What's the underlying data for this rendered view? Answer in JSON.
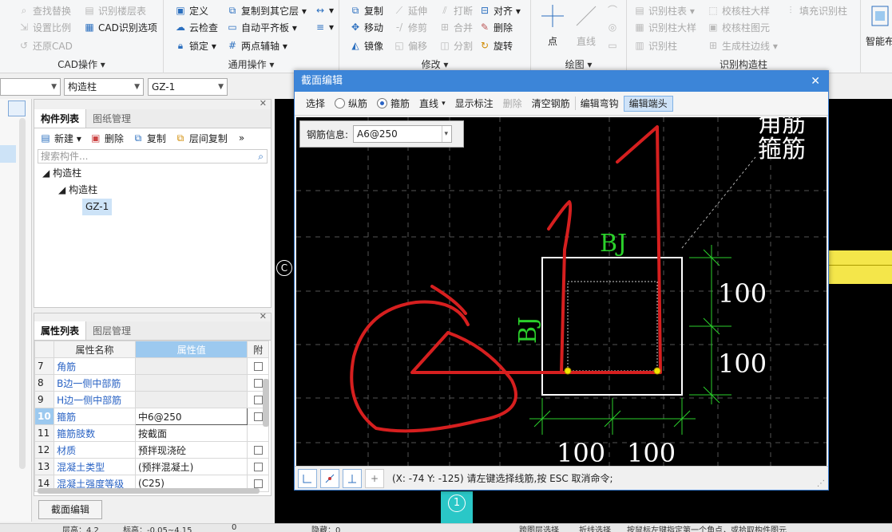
{
  "ribbon": {
    "g1": {
      "title": "CAD操作 ▾",
      "items": [
        "查找替换",
        "识别楼层表",
        "设置比例",
        "CAD识别选项",
        "还原CAD"
      ]
    },
    "g2": {
      "title": "通用操作 ▾",
      "items": [
        "定义",
        "复制到其它层 ▾",
        "云检查",
        "自动平齐板 ▾",
        "锁定 ▾",
        "两点辅轴 ▾"
      ]
    },
    "g3": {
      "title": "修改 ▾",
      "items": [
        "复制",
        "延伸",
        "打断",
        "对齐 ▾",
        "移动",
        "修剪",
        "合并",
        "删除",
        "镜像",
        "偏移",
        "分割",
        "旋转"
      ]
    },
    "g4": {
      "title": "绘图 ▾",
      "items": [
        "点",
        "直线"
      ]
    },
    "g5": {
      "title": "识别构造柱",
      "items": [
        "识别柱表 ▾",
        "校核柱大样",
        "填充识别柱",
        "识别柱大样",
        "校核柱图元",
        "识别柱",
        "生成柱边线 ▾"
      ]
    },
    "g6": {
      "items": [
        "智能布"
      ]
    }
  },
  "selectors": {
    "category": "构造柱",
    "element": "GZ-1"
  },
  "component_panel": {
    "tabs": [
      "构件列表",
      "图纸管理"
    ],
    "toolbar": [
      "新建 ▾",
      "删除",
      "复制",
      "层间复制"
    ],
    "search_placeholder": "搜索构件...",
    "tree": [
      "构造柱",
      "构造柱",
      "GZ-1"
    ]
  },
  "property_panel": {
    "tabs": [
      "属性列表",
      "图层管理"
    ],
    "headers": [
      "属性名称",
      "属性值",
      "附"
    ],
    "rows": [
      {
        "n": "7",
        "name": "角筋",
        "val": "",
        "chk": true
      },
      {
        "n": "8",
        "name": "B边一侧中部筋",
        "val": "",
        "chk": true
      },
      {
        "n": "9",
        "name": "H边一侧中部筋",
        "val": "",
        "chk": true
      },
      {
        "n": "10",
        "name": "箍筋",
        "val": "中6@250",
        "chk": true
      },
      {
        "n": "11",
        "name": "箍筋肢数",
        "val": "按截面",
        "chk": false
      },
      {
        "n": "12",
        "name": "材质",
        "val": "预拌现浇砼",
        "chk": true
      },
      {
        "n": "13",
        "name": "混凝土类型",
        "val": "(预拌混凝土)",
        "chk": true
      },
      {
        "n": "14",
        "name": "混凝土强度等级",
        "val": "(C25)",
        "chk": true
      }
    ],
    "section_edit_button": "截面编辑"
  },
  "dialog": {
    "title": "截面编辑",
    "toolbar": {
      "select": "选择",
      "longitudinal": "纵筋",
      "stirrup": "箍筋",
      "line": "直线",
      "show_label": "显示标注",
      "delete": "删除",
      "clear": "清空钢筋",
      "edit_hook": "编辑弯钩",
      "edit_end": "编辑端头"
    },
    "rebar_label": "钢筋信息:",
    "rebar_value": "A6@250",
    "canvas_texts": {
      "stirrup_label": "箍筋",
      "top_partial": "角筋",
      "bj_top": "BJ",
      "bj_left": "BJ",
      "dim_right_1": "100",
      "dim_right_2": "100",
      "dim_bottom_1": "100",
      "dim_bottom_2": "100"
    },
    "status": "(X: -74 Y: -125)  请左键选择线筋,按 ESC 取消命令;"
  },
  "canvas_marker": "C",
  "axis_label": "1",
  "bottom_bar": [
    "层高：4.2",
    "标高：-0.05~4.15",
    "0",
    "隐藏：0",
    "跨图层选择",
    "折线选择",
    "按鼠标左键指定第一个角点，或拾取构件图元"
  ]
}
